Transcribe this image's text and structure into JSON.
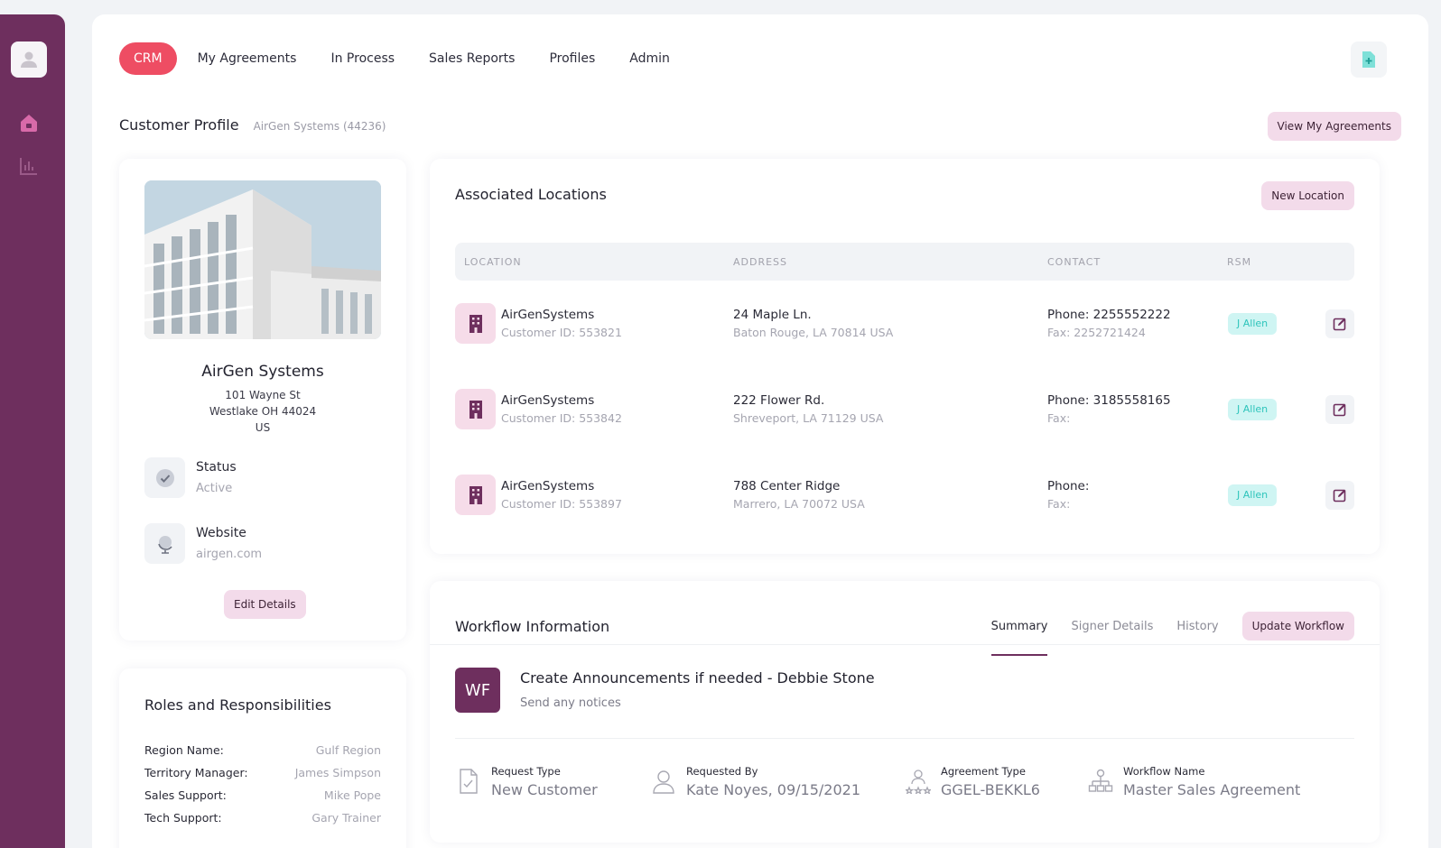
{
  "nav": {
    "tabs": [
      "CRM",
      "My Agreements",
      "In Process",
      "Sales Reports",
      "Profiles",
      "Admin"
    ],
    "active_tab": "CRM"
  },
  "header": {
    "title": "Customer Profile",
    "subtitle": "AirGen Systems (44236)",
    "view_agreements_label": "View My Agreements"
  },
  "customer": {
    "name": "AirGen Systems",
    "address_line1": "101 Wayne St",
    "address_line2": "Westlake OH 44024",
    "country": "US",
    "status_label": "Status",
    "status_value": "Active",
    "website_label": "Website",
    "website_value": "airgen.com",
    "edit_label": "Edit Details"
  },
  "roles": {
    "title": "Roles and Responsibilities",
    "items": [
      {
        "label": "Region Name:",
        "value": "Gulf Region"
      },
      {
        "label": "Territory Manager:",
        "value": "James Simpson"
      },
      {
        "label": "Sales Support:",
        "value": "Mike Pope"
      },
      {
        "label": "Tech Support:",
        "value": "Gary Trainer"
      }
    ]
  },
  "locations": {
    "title": "Associated Locations",
    "new_label": "New Location",
    "columns": [
      "LOCATION",
      "ADDRESS",
      "CONTACT",
      "RSM"
    ],
    "rows": [
      {
        "name": "AirGenSystems",
        "customer_id": "Customer ID: 553821",
        "street": "24 Maple Ln.",
        "city": "Baton Rouge, LA 70814 USA",
        "phone": "Phone: 2255552222",
        "fax": "Fax: 2252721424",
        "rsm": "J Allen"
      },
      {
        "name": "AirGenSystems",
        "customer_id": "Customer ID: 553842",
        "street": "222 Flower Rd.",
        "city": "Shreveport, LA 71129 USA",
        "phone": "Phone: 3185558165",
        "fax": "Fax:",
        "rsm": "J Allen"
      },
      {
        "name": "AirGenSystems",
        "customer_id": "Customer ID: 553897",
        "street": "788 Center Ridge",
        "city": "Marrero, LA 70072 USA",
        "phone": "Phone:",
        "fax": "Fax:",
        "rsm": "J Allen"
      }
    ]
  },
  "workflow": {
    "title": "Workflow Information",
    "tabs": [
      "Summary",
      "Signer Details",
      "History"
    ],
    "active_tab": "Summary",
    "update_label": "Update Workflow",
    "badge": "WF",
    "task": "Create Announcements if needed - Debbie Stone",
    "task_sub": "Send any notices",
    "meta": [
      {
        "label": "Request Type",
        "value": "New Customer",
        "icon": "document-check-icon"
      },
      {
        "label": "Requested By",
        "value": "Kate Noyes, 09/15/2021",
        "icon": "person-icon"
      },
      {
        "label": "Agreement Type",
        "value": "GGEL-BEKKL6",
        "icon": "person-stars-icon"
      },
      {
        "label": "Workflow Name",
        "value": "Master Sales Agreement",
        "icon": "org-chart-icon"
      }
    ]
  },
  "colors": {
    "sidebar": "#6e2f5e",
    "accent": "#ee4d63",
    "pill": "#f3dbea",
    "rsm_badge": "#cff5f3"
  }
}
